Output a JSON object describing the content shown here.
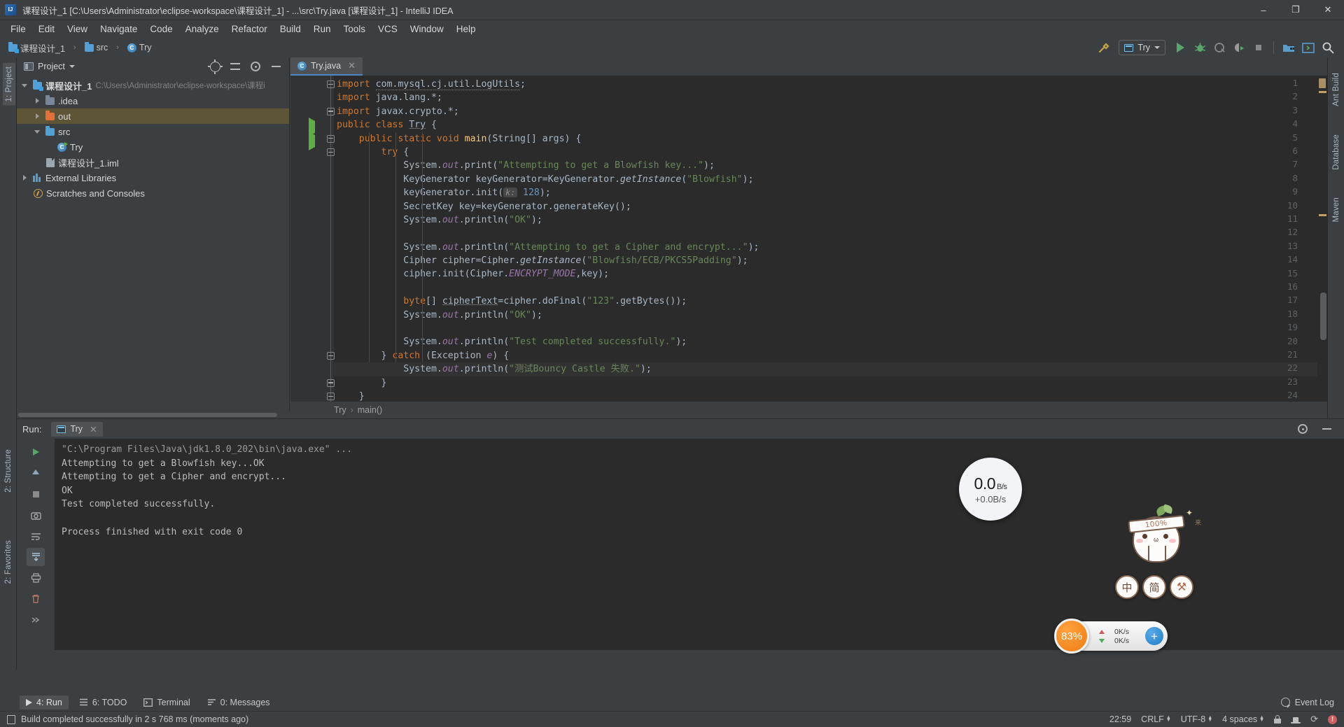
{
  "window": {
    "title": "课程设计_1 [C:\\Users\\Administrator\\eclipse-workspace\\课程设计_1] - ...\\src\\Try.java [课程设计_1] - IntelliJ IDEA",
    "app_icon": "intellij-idea-icon",
    "minimize": "–",
    "maximize": "❐",
    "close": "✕"
  },
  "menubar": {
    "items": [
      {
        "label": "File"
      },
      {
        "label": "Edit"
      },
      {
        "label": "View"
      },
      {
        "label": "Navigate"
      },
      {
        "label": "Code"
      },
      {
        "label": "Analyze"
      },
      {
        "label": "Refactor"
      },
      {
        "label": "Build"
      },
      {
        "label": "Run"
      },
      {
        "label": "Tools"
      },
      {
        "label": "VCS"
      },
      {
        "label": "Window"
      },
      {
        "label": "Help"
      }
    ]
  },
  "navbar": {
    "breadcrumb": [
      {
        "label": "课程设计_1",
        "icon": "module-folder-icon"
      },
      {
        "label": "src",
        "icon": "source-folder-icon"
      },
      {
        "label": "Try",
        "icon": "java-class-icon"
      }
    ],
    "separator": "›",
    "run_config": {
      "label": "Try",
      "icon": "run-config-icon",
      "dropdown": "▾"
    },
    "buttons": [
      {
        "name": "build-hammer-button",
        "icon": "hammer-icon"
      },
      {
        "name": "run-button",
        "icon": "run-triangle-icon"
      },
      {
        "name": "debug-button",
        "icon": "debug-bug-icon"
      },
      {
        "name": "run-with-coverage-button",
        "icon": "coverage-icon"
      },
      {
        "name": "profile-button",
        "icon": "profiler-icon"
      },
      {
        "name": "stop-button",
        "icon": "stop-square-icon"
      },
      {
        "name": "project-structure-button",
        "icon": "project-structure-icon"
      },
      {
        "name": "settings-button",
        "icon": "terminal-window-icon"
      },
      {
        "name": "search-everywhere-button",
        "icon": "search-icon"
      }
    ]
  },
  "left_rail": {
    "items": [
      {
        "label": "1: Project",
        "selected": true
      },
      {
        "label": "2: Structure",
        "selected": false
      },
      {
        "label": "2: Favorites",
        "selected": false
      }
    ]
  },
  "right_rail": {
    "items": [
      {
        "label": "Ant Build",
        "icon": "ant-icon"
      },
      {
        "label": "Database",
        "icon": "database-icon"
      },
      {
        "label": "Maven",
        "icon": "maven-icon"
      }
    ]
  },
  "project_panel": {
    "title": "Project",
    "title_dropdown": "▾",
    "tools": [
      {
        "name": "scroll-from-source-button",
        "icon": "locate-icon"
      },
      {
        "name": "collapse-all-button",
        "icon": "collapse-all-icon"
      },
      {
        "name": "panel-settings-button",
        "icon": "gear-icon"
      },
      {
        "name": "hide-panel-button",
        "icon": "minus-icon"
      }
    ],
    "tree": [
      {
        "name": "课程设计_1",
        "detail": "C:\\Users\\Administrator\\eclipse-workspace\\课程i",
        "arrow": "down",
        "icon": "module-folder-icon",
        "indent": 0,
        "bold": true,
        "selected": false
      },
      {
        "name": ".idea",
        "detail": "",
        "arrow": "right",
        "icon": "folder-icon",
        "indent": 1,
        "bold": false,
        "selected": false
      },
      {
        "name": "out",
        "detail": "",
        "arrow": "right",
        "icon": "excluded-folder-icon",
        "indent": 1,
        "bold": false,
        "selected": true
      },
      {
        "name": "src",
        "detail": "",
        "arrow": "down",
        "icon": "source-folder-icon",
        "indent": 1,
        "bold": false,
        "selected": false
      },
      {
        "name": "Try",
        "detail": "",
        "arrow": "none",
        "icon": "java-class-icon",
        "indent": 2,
        "bold": false,
        "selected": false
      },
      {
        "name": "课程设计_1.iml",
        "detail": "",
        "arrow": "none",
        "icon": "iml-file-icon",
        "indent": 1,
        "bold": false,
        "selected": false
      },
      {
        "name": "External Libraries",
        "detail": "",
        "arrow": "right",
        "icon": "libraries-icon",
        "indent": 0,
        "bold": false,
        "selected": false
      },
      {
        "name": "Scratches and Consoles",
        "detail": "",
        "arrow": "none",
        "icon": "scratches-icon",
        "indent": 0,
        "bold": false,
        "selected": false
      }
    ]
  },
  "editor": {
    "tab": {
      "label": "Try.java",
      "icon": "java-class-icon",
      "close": "✕"
    },
    "breadcrumb": [
      "Try",
      "main()"
    ],
    "breadcrumb_sep": "›",
    "lines": [
      {
        "n": "1",
        "html": "<span class=\"kw\">import</span> <span class=\"warn-u\">com.mysql.cj.util.LogUtils</span>;",
        "run": false,
        "fold": "open",
        "hl": false
      },
      {
        "n": "2",
        "html": "<span class=\"kw\">import</span> java.lang.*;",
        "run": false,
        "fold": "",
        "hl": false
      },
      {
        "n": "3",
        "html": "<span class=\"kw\">import</span> javax.crypto.*;",
        "run": false,
        "fold": "close",
        "hl": false
      },
      {
        "n": "4",
        "html": "<span class=\"kw\">public class</span> <span class=\"ident-u\">Try</span> {",
        "run": true,
        "fold": "",
        "hl": false
      },
      {
        "n": "5",
        "html": "    <span class=\"kw\">public static void</span> <span class=\"fn\">main</span>(String[] args) {",
        "run": true,
        "fold": "open",
        "hl": false
      },
      {
        "n": "6",
        "html": "        <span class=\"kw\">try</span> {",
        "run": false,
        "fold": "open",
        "hl": false
      },
      {
        "n": "7",
        "html": "            System.<span class=\"st-i\">out</span>.print(<span class=\"st\">\"Attempting to get a Blowfish key...\"</span>);",
        "run": false,
        "fold": "",
        "hl": false
      },
      {
        "n": "8",
        "html": "            KeyGenerator keyGenerator=KeyGenerator.<span class=\"mth-i\">getInstance</span>(<span class=\"st\">\"Blowfish\"</span>);",
        "run": false,
        "fold": "",
        "hl": false
      },
      {
        "n": "9",
        "html": "            keyGenerator.init(<span class=\"hint\">k:</span> <span class=\"nm\">128</span>);",
        "run": false,
        "fold": "",
        "hl": false
      },
      {
        "n": "10",
        "html": "            SecretKey key=keyGenerator.generateKey();",
        "run": false,
        "fold": "",
        "hl": false
      },
      {
        "n": "11",
        "html": "            System.<span class=\"st-i\">out</span>.println(<span class=\"st\">\"OK\"</span>);",
        "run": false,
        "fold": "",
        "hl": false
      },
      {
        "n": "12",
        "html": "",
        "run": false,
        "fold": "",
        "hl": false
      },
      {
        "n": "13",
        "html": "            System.<span class=\"st-i\">out</span>.println(<span class=\"st\">\"Attempting to get a Cipher and encrypt...\"</span>);",
        "run": false,
        "fold": "",
        "hl": false
      },
      {
        "n": "14",
        "html": "            Cipher cipher=Cipher.<span class=\"mth-i\">getInstance</span>(<span class=\"st\">\"Blowfish/ECB/PKCS5Padding\"</span>);",
        "run": false,
        "fold": "",
        "hl": false
      },
      {
        "n": "15",
        "html": "            cipher.init(Cipher.<span class=\"st-i\">ENCRYPT_MODE</span>,key);",
        "run": false,
        "fold": "",
        "hl": false
      },
      {
        "n": "16",
        "html": "",
        "run": false,
        "fold": "",
        "hl": false
      },
      {
        "n": "17",
        "html": "            <span class=\"kw\">byte</span>[] <span class=\"ident-u\">cipherText</span>=cipher.doFinal(<span class=\"st\">\"123\"</span>.getBytes());",
        "run": false,
        "fold": "",
        "hl": false
      },
      {
        "n": "18",
        "html": "            System.<span class=\"st-i\">out</span>.println(<span class=\"st\">\"OK\"</span>);",
        "run": false,
        "fold": "",
        "hl": false
      },
      {
        "n": "19",
        "html": "",
        "run": false,
        "fold": "",
        "hl": false
      },
      {
        "n": "20",
        "html": "            System.<span class=\"st-i\">out</span>.println(<span class=\"st\">\"Test completed successfully.\"</span>);",
        "run": false,
        "fold": "",
        "hl": false
      },
      {
        "n": "21",
        "html": "        } <span class=\"kw\">catch</span> (Exception <span class=\"st-i\">e</span>) {",
        "run": false,
        "fold": "close",
        "hl": false
      },
      {
        "n": "22",
        "html": "            System.<span class=\"st-i\">out</span>.println(<span class=\"st\">\"测试Bouncy Castle 失败.\"</span>);",
        "run": false,
        "fold": "",
        "hl": true
      },
      {
        "n": "23",
        "html": "        }",
        "run": false,
        "fold": "close",
        "hl": false
      },
      {
        "n": "24",
        "html": "    }",
        "run": false,
        "fold": "close",
        "hl": false
      }
    ]
  },
  "run_window": {
    "label": "Run:",
    "tab": {
      "label": "Try",
      "icon": "run-config-icon",
      "close": "✕"
    },
    "sidebar_buttons": [
      {
        "name": "rerun-button",
        "icon": "run-triangle-icon"
      },
      {
        "name": "scroll-up-button",
        "icon": "arrow-up-icon"
      },
      {
        "name": "stop-button",
        "icon": "stop-square-icon"
      },
      {
        "name": "camera-button",
        "icon": "camera-icon"
      },
      {
        "name": "soft-wrap-button",
        "icon": "wrap-icon"
      },
      {
        "name": "scroll-to-end-button",
        "icon": "scroll-end-icon"
      },
      {
        "name": "print-button",
        "icon": "printer-icon"
      },
      {
        "name": "clear-all-button",
        "icon": "trash-icon"
      },
      {
        "name": "more-button",
        "icon": "chevrons-icon"
      }
    ],
    "header_buttons": [
      {
        "name": "run-settings-button",
        "icon": "gear-icon"
      },
      {
        "name": "hide-run-panel-button",
        "icon": "minus-icon"
      }
    ],
    "console": [
      {
        "text": "\"C:\\Program Files\\Java\\jdk1.8.0_202\\bin\\java.exe\" ...",
        "muted": true
      },
      {
        "text": "Attempting to get a Blowfish key...OK",
        "muted": false
      },
      {
        "text": "Attempting to get a Cipher and encrypt...",
        "muted": false
      },
      {
        "text": "OK",
        "muted": false
      },
      {
        "text": "Test completed successfully.",
        "muted": false
      },
      {
        "text": "",
        "muted": false
      },
      {
        "text": "Process finished with exit code 0",
        "muted": false
      }
    ]
  },
  "bottom_strip": {
    "items": [
      {
        "label": "4: Run",
        "key": "4",
        "icon": "run-triangle-icon",
        "active": true
      },
      {
        "label": "6: TODO",
        "key": "6",
        "icon": "todo-list-icon",
        "active": false
      },
      {
        "label": "Terminal",
        "key": "",
        "icon": "terminal-icon",
        "active": false
      },
      {
        "label": "0: Messages",
        "key": "0",
        "icon": "messages-icon",
        "active": false
      }
    ],
    "event_log": "Event Log"
  },
  "status_bar": {
    "message": "Build completed successfully in 2 s 768 ms (moments ago)",
    "message_icon": "build-icon",
    "time": "22:59",
    "line_separator": "CRLF",
    "encoding": "UTF-8",
    "indent": "4 spaces",
    "stepper": "↕",
    "icons": [
      {
        "name": "lock-icon"
      },
      {
        "name": "hat-inspection-icon"
      },
      {
        "name": "refresh-icon"
      },
      {
        "name": "error-badge-icon"
      }
    ]
  },
  "widgets": {
    "speed_ball": {
      "value": "0.0",
      "unit": "B/s",
      "delta": "+0.0B/s"
    },
    "mascot": {
      "band_text": "100%",
      "kanji": "来",
      "sparkle": "✦"
    },
    "lang_buttons": [
      {
        "label": "中",
        "name": "language-chinese-button"
      },
      {
        "label": "简",
        "name": "language-simplified-button"
      },
      {
        "label": "⚒",
        "name": "toolbox-button"
      }
    ],
    "net_bar": {
      "percent": "83%",
      "upload": "0K/s",
      "download": "0K/s",
      "plus": "+"
    }
  }
}
